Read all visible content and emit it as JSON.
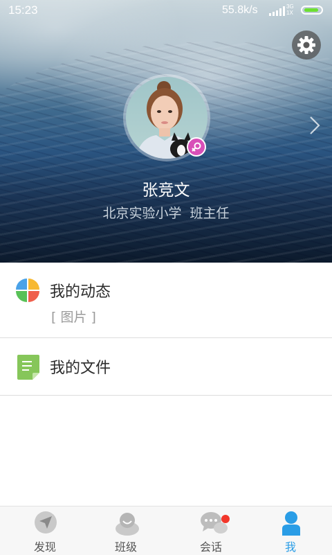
{
  "status_bar": {
    "time": "15:23",
    "net_speed": "55.8k/s",
    "net_type_top": "3G",
    "net_type_bottom": "1X"
  },
  "profile": {
    "name": "张竞文",
    "school": "北京实验小学",
    "role": "班主任",
    "gender_icon": "female-symbol-icon",
    "badge_color": "#d84fb8"
  },
  "menu": {
    "dynamics": {
      "label": "我的动态",
      "latest": "[ 图片 ]"
    },
    "files": {
      "label": "我的文件"
    }
  },
  "bottom_nav": {
    "tabs": [
      {
        "label": "发现",
        "icon": "compass-icon"
      },
      {
        "label": "班级",
        "icon": "class-icon"
      },
      {
        "label": "会话",
        "icon": "chat-icon"
      },
      {
        "label": "我",
        "icon": "person-icon"
      }
    ],
    "active_color": "#2a9de6",
    "active_tab": "我"
  },
  "colors": {
    "battery": "#6cdf31",
    "unread_dot": "#f2372b"
  }
}
